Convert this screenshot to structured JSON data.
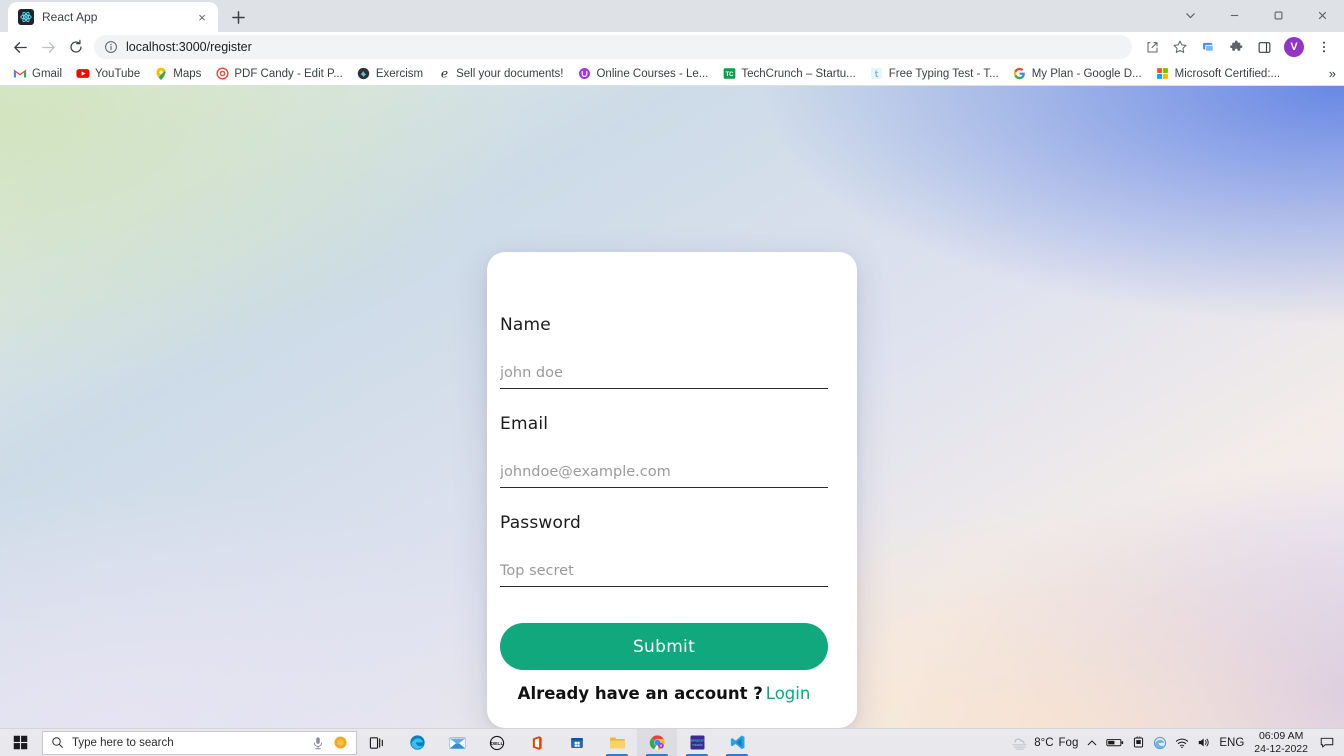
{
  "browser": {
    "tab": {
      "title": "React App",
      "favicon": "react-logo-icon",
      "close": "×"
    },
    "new_tab_label": "+",
    "window_controls": {
      "tab_search": "tab-search-chevron-icon",
      "minimize": "minimize-icon",
      "maximize": "maximize-icon",
      "close": "close-icon"
    },
    "nav": {
      "back": "back-arrow-icon",
      "forward": "forward-arrow-icon",
      "reload": "reload-icon"
    },
    "omnibox": {
      "site_info_icon": "info-circle-icon",
      "url": "localhost:3000/register"
    },
    "toolbar_right": {
      "share": "share-icon",
      "bookmark": "star-icon",
      "cast": "cast-icon",
      "extensions": "puzzle-piece-icon",
      "side_panel": "side-panel-icon",
      "avatar_initial": "V",
      "menu": "three-dot-menu-icon"
    },
    "bookmarks": [
      {
        "label": "Gmail",
        "icon": "gmail-icon"
      },
      {
        "label": "YouTube",
        "icon": "youtube-icon"
      },
      {
        "label": "Maps",
        "icon": "maps-pin-icon"
      },
      {
        "label": "PDF Candy - Edit P...",
        "icon": "pdf-candy-icon"
      },
      {
        "label": "Exercism",
        "icon": "exercism-icon"
      },
      {
        "label": "Sell your documents!",
        "icon": "studocu-icon"
      },
      {
        "label": "Online Courses - Le...",
        "icon": "udemy-icon"
      },
      {
        "label": "TechCrunch – Startu...",
        "icon": "techcrunch-icon"
      },
      {
        "label": "Free Typing Test - T...",
        "icon": "typing-test-icon"
      },
      {
        "label": "My Plan - Google D...",
        "icon": "google-icon"
      },
      {
        "label": "Microsoft Certified:...",
        "icon": "microsoft-icon"
      }
    ],
    "bookmarks_overflow": "»"
  },
  "page": {
    "form": {
      "fields": [
        {
          "label": "Name",
          "placeholder": "john doe",
          "value": "",
          "type": "text"
        },
        {
          "label": "Email",
          "placeholder": "johndoe@example.com",
          "value": "",
          "type": "email"
        },
        {
          "label": "Password",
          "placeholder": "Top secret",
          "value": "",
          "type": "password"
        }
      ],
      "submit_label": "Submit",
      "footnote_text": "Already have an account ?",
      "login_link_label": "Login"
    },
    "colors": {
      "accent_green": "#10a87c",
      "card_background": "#ffffff",
      "input_underline": "#2b2b2b",
      "placeholder": "#9a9a9a"
    }
  },
  "taskbar": {
    "start": "windows-start-icon",
    "search_placeholder": "Type here to search",
    "search_icons": {
      "magnifier": "search-icon",
      "cortana": "microphone-icon",
      "highlight": "cortana-circle-icon"
    },
    "task_view": "task-view-icon",
    "apps": [
      {
        "name": "edge-icon",
        "active": false,
        "running": false
      },
      {
        "name": "mail-icon",
        "active": false,
        "running": false
      },
      {
        "name": "dell-icon",
        "active": false,
        "running": false
      },
      {
        "name": "office-icon",
        "active": false,
        "running": false
      },
      {
        "name": "microsoft-store-icon",
        "active": false,
        "running": false
      },
      {
        "name": "file-explorer-icon",
        "active": false,
        "running": true
      },
      {
        "name": "chrome-icon",
        "active": true,
        "running": true
      },
      {
        "name": "amazon-music-icon",
        "active": false,
        "running": true
      },
      {
        "name": "vs-code-icon",
        "active": false,
        "running": true
      }
    ],
    "tray": {
      "weather_temp": "8°C",
      "weather_condition": "Fog",
      "weather_icon": "cloud-fog-icon",
      "show_hidden": "chevron-up-icon",
      "battery": "battery-icon",
      "onedrive_or_device": "device-icon",
      "edge_sync": "edge-tray-icon",
      "wifi": "wifi-icon",
      "volume": "speaker-icon",
      "language": "ENG",
      "time": "06:09 AM",
      "date": "24-12-2022",
      "action_center": "notification-icon"
    }
  }
}
